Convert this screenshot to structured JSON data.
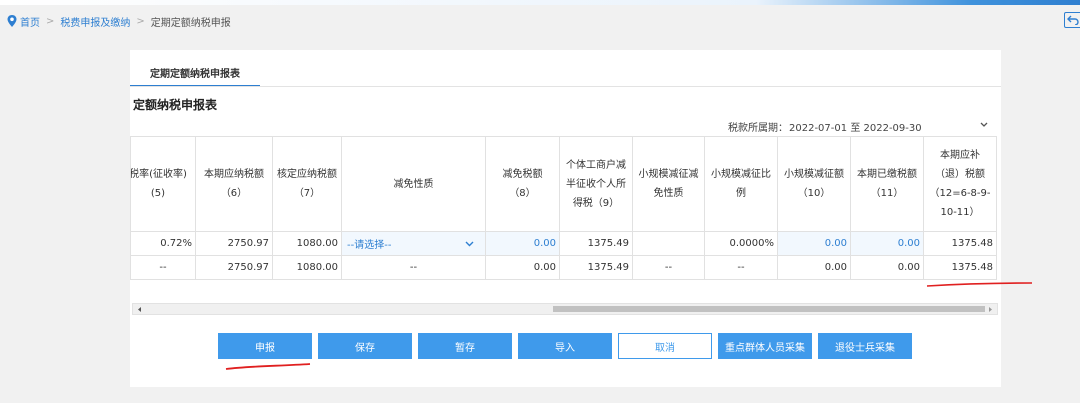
{
  "breadcrumb": {
    "home": "首页",
    "section": "税费申报及缴纳",
    "current": "定期定额纳税申报"
  },
  "tab": {
    "label": "定期定额纳税申报表"
  },
  "form": {
    "title": "定额纳税申报表",
    "period_label": "税款所属期：",
    "period_start": "2022-07-01",
    "period_sep": "至",
    "period_end": "2022-09-30"
  },
  "table": {
    "headers": [
      "税率(征收率)\n(5)",
      "本期应纳税额\n（6）",
      "核定应纳税额\n（7）",
      "减免性质",
      "减免税额\n（8）",
      "个体工商户减半征收个人所得税（9）",
      "小规模减征减免性质",
      "小规模减征比例",
      "小规模减征额\n（10）",
      "本期已缴税额\n（11）",
      "本期应补（退）税额（12=6-8-9-10-11）"
    ],
    "row1": {
      "rate": "0.72%",
      "payable": "2750.97",
      "assessed": "1080.00",
      "exempt_nature": "--请选择--",
      "exempt_amount": "0.00",
      "half_tax": "1375.49",
      "small_nature": "",
      "small_ratio": "0.0000%",
      "small_amount": "0.00",
      "paid": "0.00",
      "due": "1375.48"
    },
    "row2": {
      "rate": "--",
      "payable": "2750.97",
      "assessed": "1080.00",
      "exempt_nature": "--",
      "exempt_amount": "0.00",
      "half_tax": "1375.49",
      "small_nature": "--",
      "small_ratio": "--",
      "small_amount": "0.00",
      "paid": "0.00",
      "due": "1375.48"
    }
  },
  "buttons": {
    "declare": "申报",
    "save": "保存",
    "hold": "暂存",
    "import": "导入",
    "cancel": "取消",
    "key_group": "重点群体人员采集",
    "veteran": "退役士兵采集"
  },
  "colors": {
    "accent": "#2e7fd1",
    "button": "#3f9aeb",
    "annotation": "#e02020"
  },
  "icons": {
    "breadcrumb": "location-pin-icon",
    "back": "return-icon",
    "collapse": "chevron-down-icon"
  }
}
